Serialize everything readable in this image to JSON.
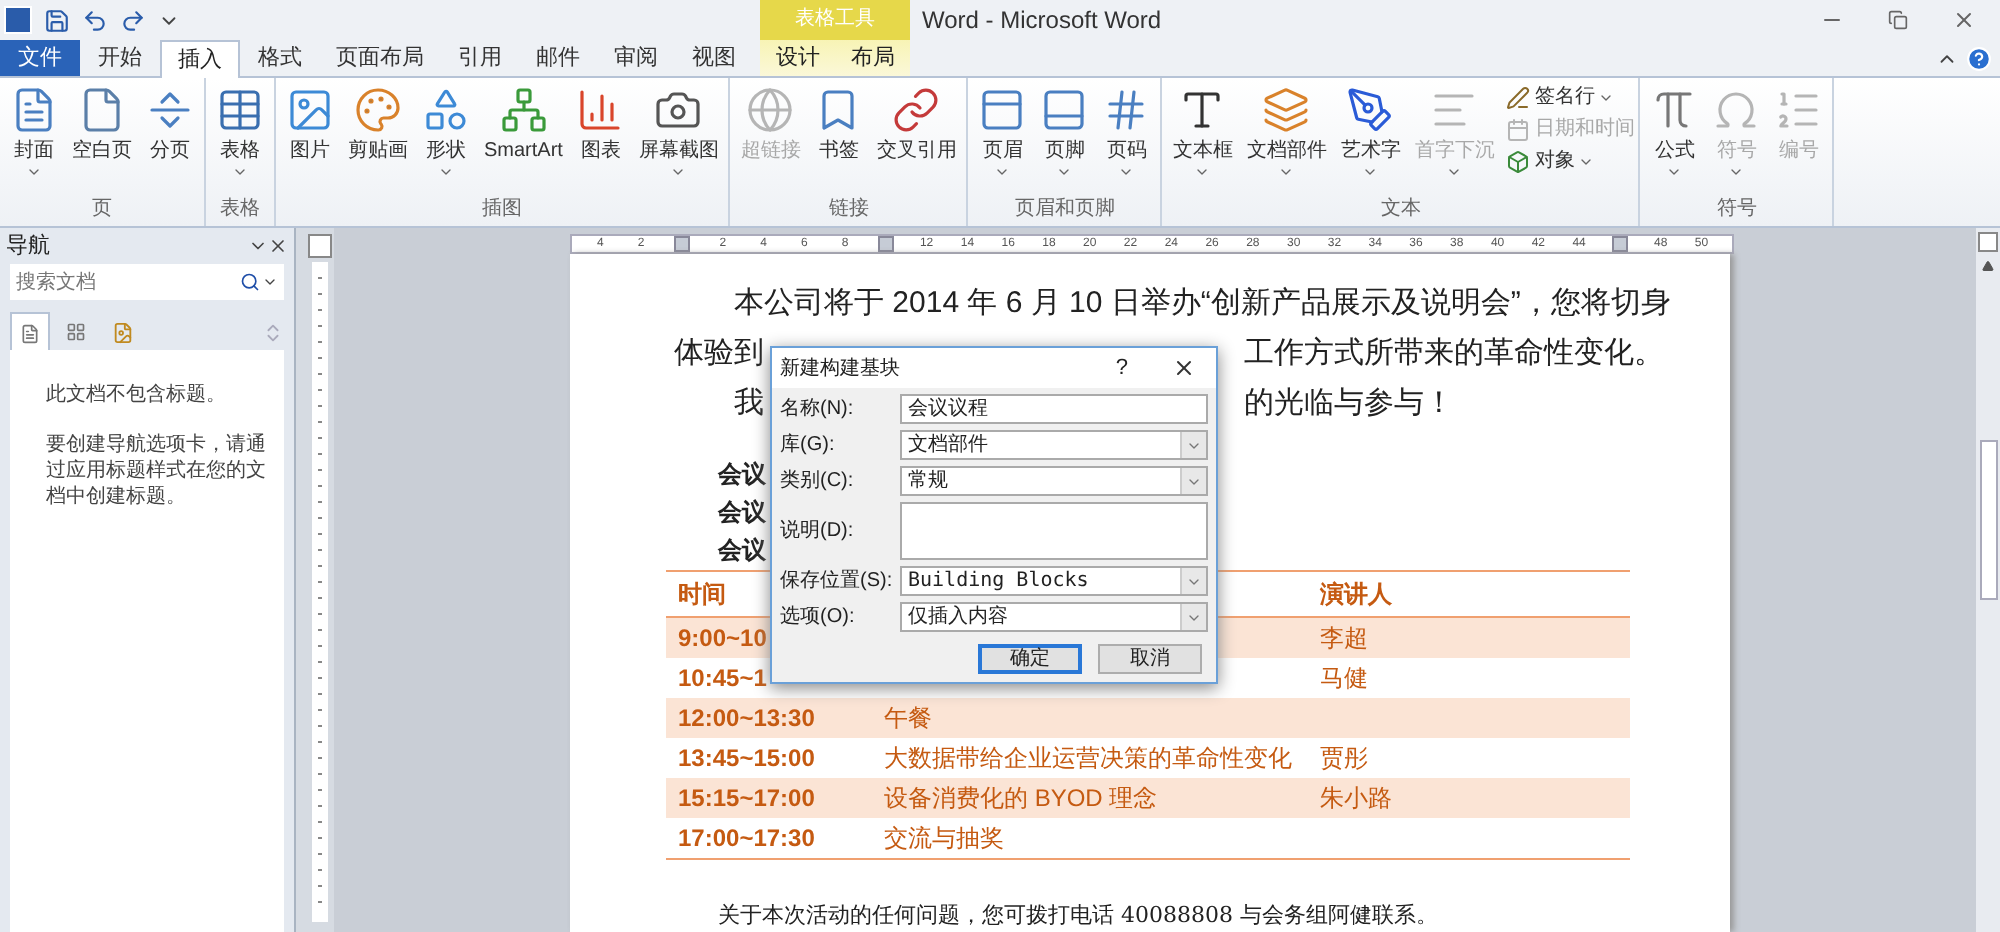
{
  "window": {
    "title": "Word - Microsoft Word"
  },
  "tabs": [
    {
      "label": "文件",
      "kind": "file",
      "selected": false
    },
    {
      "label": "开始",
      "kind": "tab",
      "selected": false
    },
    {
      "label": "插入",
      "kind": "tab",
      "selected": true
    },
    {
      "label": "格式",
      "kind": "tab",
      "selected": false
    },
    {
      "label": "页面布局",
      "kind": "tab",
      "selected": false
    },
    {
      "label": "引用",
      "kind": "tab",
      "selected": false
    },
    {
      "label": "邮件",
      "kind": "tab",
      "selected": false
    },
    {
      "label": "审阅",
      "kind": "tab",
      "selected": false
    },
    {
      "label": "视图",
      "kind": "tab",
      "selected": false
    }
  ],
  "context_tabs": {
    "label": "表格工具",
    "tabs": [
      {
        "label": "设计",
        "selected": false
      },
      {
        "label": "布局",
        "selected": false
      }
    ]
  },
  "ribbon": {
    "groups": [
      {
        "label": "页",
        "items": [
          {
            "kind": "large",
            "label": "封面",
            "dropdown": true,
            "disabled": false
          },
          {
            "kind": "large",
            "label": "空白页",
            "dropdown": false,
            "disabled": false
          },
          {
            "kind": "large",
            "label": "分页",
            "dropdown": false,
            "disabled": false
          }
        ]
      },
      {
        "label": "表格",
        "items": [
          {
            "kind": "large",
            "label": "表格",
            "dropdown": true,
            "disabled": false
          }
        ]
      },
      {
        "label": "插图",
        "items": [
          {
            "kind": "large",
            "label": "图片",
            "dropdown": false,
            "disabled": false
          },
          {
            "kind": "large",
            "label": "剪贴画",
            "dropdown": false,
            "disabled": false
          },
          {
            "kind": "large",
            "label": "形状",
            "dropdown": true,
            "disabled": false
          },
          {
            "kind": "large",
            "label": "SmartArt",
            "dropdown": false,
            "disabled": false
          },
          {
            "kind": "large",
            "label": "图表",
            "dropdown": false,
            "disabled": false
          },
          {
            "kind": "large",
            "label": "屏幕截图",
            "dropdown": true,
            "disabled": false
          }
        ]
      },
      {
        "label": "链接",
        "items": [
          {
            "kind": "large",
            "label": "超链接",
            "dropdown": false,
            "disabled": true
          },
          {
            "kind": "large",
            "label": "书签",
            "dropdown": false,
            "disabled": false
          },
          {
            "kind": "large",
            "label": "交叉引用",
            "dropdown": false,
            "disabled": false
          }
        ]
      },
      {
        "label": "页眉和页脚",
        "items": [
          {
            "kind": "large",
            "label": "页眉",
            "dropdown": true,
            "disabled": false
          },
          {
            "kind": "large",
            "label": "页脚",
            "dropdown": true,
            "disabled": false
          },
          {
            "kind": "large",
            "label": "页码",
            "dropdown": true,
            "disabled": false
          }
        ]
      },
      {
        "label": "文本",
        "items": [
          {
            "kind": "large",
            "label": "文本框",
            "dropdown": true,
            "disabled": false
          },
          {
            "kind": "large",
            "label": "文档部件",
            "dropdown": true,
            "disabled": false
          },
          {
            "kind": "large",
            "label": "艺术字",
            "dropdown": true,
            "disabled": false
          },
          {
            "kind": "large",
            "label": "首字下沉",
            "dropdown": true,
            "disabled": true
          },
          {
            "kind": "small",
            "label": "签名行",
            "dropdown": true,
            "disabled": false
          },
          {
            "kind": "small",
            "label": "日期和时间",
            "dropdown": false,
            "disabled": true
          },
          {
            "kind": "small",
            "label": "对象",
            "dropdown": true,
            "disabled": false
          }
        ]
      },
      {
        "label": "符号",
        "items": [
          {
            "kind": "large",
            "label": "公式",
            "dropdown": true,
            "disabled": false
          },
          {
            "kind": "large",
            "label": "符号",
            "dropdown": true,
            "disabled": true
          },
          {
            "kind": "large",
            "label": "编号",
            "dropdown": false,
            "disabled": true
          }
        ]
      }
    ]
  },
  "navigation": {
    "title": "导航",
    "search": {
      "placeholder": "搜索文档"
    },
    "messages": [
      "此文档不包含标题。",
      "要创建导航选项卡，请通过应用标题样式在您的文档中创建标题。"
    ]
  },
  "ruler": {
    "ticks": [
      {
        "kind": "number",
        "label": "4"
      },
      {
        "kind": "number",
        "label": "2"
      },
      {
        "kind": "marker"
      },
      {
        "kind": "number",
        "label": "2"
      },
      {
        "kind": "number",
        "label": "4"
      },
      {
        "kind": "number",
        "label": "6"
      },
      {
        "kind": "number",
        "label": "8"
      },
      {
        "kind": "marker"
      },
      {
        "kind": "number",
        "label": "12"
      },
      {
        "kind": "number",
        "label": "14"
      },
      {
        "kind": "number",
        "label": "16"
      },
      {
        "kind": "number",
        "label": "18"
      },
      {
        "kind": "number",
        "label": "20"
      },
      {
        "kind": "number",
        "label": "22"
      },
      {
        "kind": "number",
        "label": "24"
      },
      {
        "kind": "number",
        "label": "26"
      },
      {
        "kind": "number",
        "label": "28"
      },
      {
        "kind": "number",
        "label": "30"
      },
      {
        "kind": "number",
        "label": "32"
      },
      {
        "kind": "number",
        "label": "34"
      },
      {
        "kind": "number",
        "label": "36"
      },
      {
        "kind": "number",
        "label": "38"
      },
      {
        "kind": "number",
        "label": "40"
      },
      {
        "kind": "number",
        "label": "42"
      },
      {
        "kind": "number",
        "label": "44"
      },
      {
        "kind": "marker"
      },
      {
        "kind": "number",
        "label": "48"
      },
      {
        "kind": "number",
        "label": "50"
      }
    ]
  },
  "document": {
    "intro_lines": [
      [
        "本公司将于 2014 年 6 月 10 日举办“创新产品展示及说明会”，您将切身"
      ],
      [
        "体验到",
        "工作方式所带来的革命性变化。"
      ],
      [
        "我",
        "的光临与参与！"
      ]
    ],
    "info_lines": [
      "会议",
      "会议",
      "会议"
    ],
    "table": {
      "columns": [
        "时间",
        "",
        "演讲人"
      ],
      "rows": [
        {
          "shaded": true,
          "cells": [
            "9:00~10",
            "",
            "李超"
          ]
        },
        {
          "shaded": false,
          "cells": [
            "10:45~1",
            "",
            "马健"
          ]
        },
        {
          "shaded": true,
          "cells": [
            "12:00~13:30",
            "午餐",
            ""
          ]
        },
        {
          "shaded": false,
          "cells": [
            "13:45~15:00",
            "大数据带给企业运营决策的革命性变化",
            "贾彤"
          ]
        },
        {
          "shaded": true,
          "cells": [
            "15:15~17:00",
            "设备消费化的 BYOD 理念",
            "朱小路"
          ]
        },
        {
          "shaded": false,
          "cells": [
            "17:00~17:30",
            "交流与抽奖",
            ""
          ]
        }
      ]
    },
    "footer": "关于本次活动的任何问题，您可拨打电话 40088808 与会务组阿健联系。"
  },
  "dialog": {
    "title": "新建构建基块",
    "help": "?",
    "fields": [
      {
        "kind": "input",
        "label": "名称(N):",
        "value": "会议议程"
      },
      {
        "kind": "select",
        "label": "库(G):",
        "value": "文档部件"
      },
      {
        "kind": "select",
        "label": "类别(C):",
        "value": "常规"
      },
      {
        "kind": "textarea",
        "label": "说明(D):"
      },
      {
        "kind": "select",
        "label": "保存位置(S):",
        "value": "Building Blocks"
      },
      {
        "kind": "select",
        "label": "选项(O):",
        "value": "仅插入内容"
      }
    ],
    "buttons": [
      {
        "label": "确定",
        "default": true
      },
      {
        "label": "取消",
        "default": false
      }
    ]
  }
}
